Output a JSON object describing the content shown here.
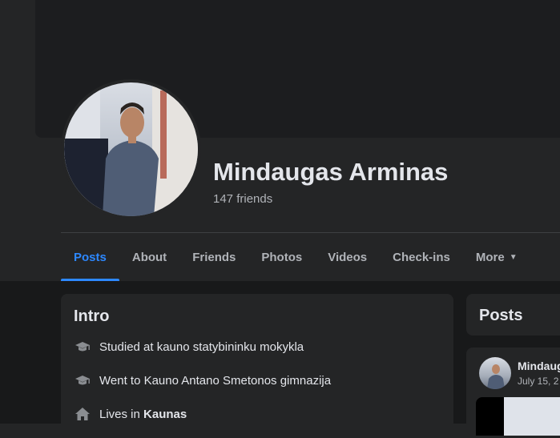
{
  "profile": {
    "name": "Mindaugas Arminas",
    "friends": "147 friends"
  },
  "tabs": [
    {
      "label": "Posts",
      "active": true
    },
    {
      "label": "About"
    },
    {
      "label": "Friends"
    },
    {
      "label": "Photos"
    },
    {
      "label": "Videos"
    },
    {
      "label": "Check-ins"
    },
    {
      "label": "More"
    }
  ],
  "intro": {
    "title": "Intro",
    "items": [
      {
        "icon": "graduation-cap-icon",
        "text": "Studied at kauno statybininku mokykla"
      },
      {
        "icon": "graduation-cap-icon",
        "text": "Went to Kauno Antano Smetonos gimnazija"
      },
      {
        "icon": "home-icon",
        "prefix": "Lives in ",
        "place": "Kaunas"
      }
    ]
  },
  "posts": {
    "title": "Posts",
    "latest": {
      "author": "Mindaug",
      "date": "July 15, 2"
    }
  },
  "colors": {
    "accent": "#2d88ff",
    "surface": "#242526",
    "background": "#18191a"
  }
}
